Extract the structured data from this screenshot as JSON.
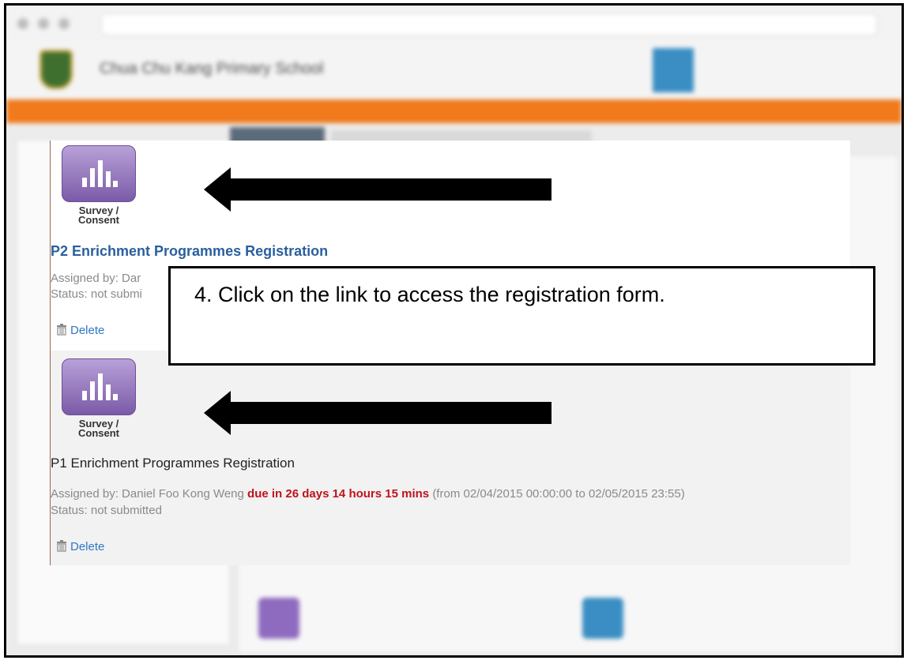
{
  "card": {
    "items": [
      {
        "icon_label": "Survey /\nConsent",
        "title": "P2 Enrichment Programmes Registration",
        "assigned": "Assigned by: Dar",
        "status": "Status: not submi",
        "delete": "Delete"
      },
      {
        "icon_label": "Survey /\nConsent",
        "title": "P1 Enrichment Programmes Registration",
        "assigned": "Assigned by: Daniel Foo Kong Weng",
        "due": "due in 26 days 14 hours 15 mins",
        "range": "(from 02/04/2015 00:00:00 to 02/05/2015 23:55)",
        "status": "Status: not submitted",
        "delete": "Delete"
      }
    ]
  },
  "callout": {
    "text": "4. Click on the link to access the registration form."
  },
  "background": {
    "school_name": "Chua Chu Kang Primary School"
  },
  "colors": {
    "orange_bar": "#f07a1c",
    "link_blue": "#2a5f9e",
    "due_red": "#c0121a",
    "icon_purple": "#7b5aa8"
  }
}
